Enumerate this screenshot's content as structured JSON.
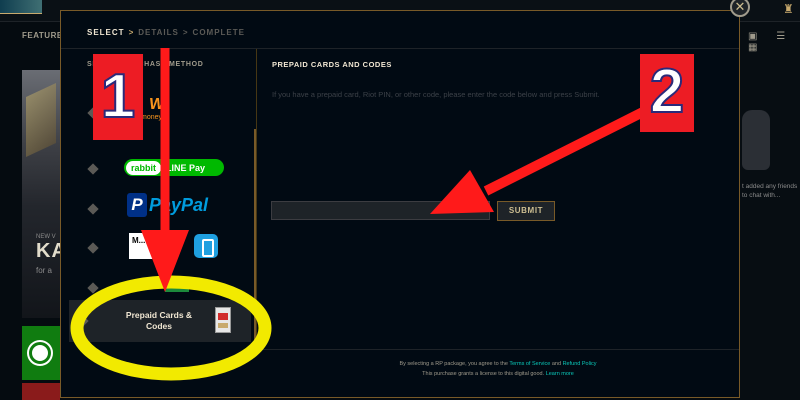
{
  "background": {
    "tab_label": "FEATURE",
    "left_small": "NEW V",
    "left_big": "KA",
    "left_sub": "for a",
    "right_text": "t added any friends to chat with...",
    "right_icons": "▣ ☰ ▦"
  },
  "modal": {
    "breadcrumb": {
      "select": "SELECT",
      "separator": ">",
      "details": "DETAILS",
      "complete": "COMPLETE"
    },
    "close": "✕",
    "sidebar": {
      "title": "SELECT PURCHASE METHOD",
      "items": [
        {
          "name": "TrueMoney",
          "text": "money",
          "diamond": true
        },
        {
          "name": "LINE Pay",
          "part1": "rabbit",
          "part2": "LINE Pay",
          "diamond": true
        },
        {
          "name": "PayPal",
          "mark": "P",
          "text": "PayPal",
          "diamond": true
        },
        {
          "name": "mPay",
          "text": "M... Pa...",
          "diamond": true
        },
        {
          "name": "7-Eleven",
          "diamond": true
        }
      ],
      "selected": {
        "label": "Prepaid Cards & Codes"
      }
    },
    "content": {
      "title": "PREPAID CARDS AND CODES",
      "description": "If you have a prepaid card, Riot PIN, or other code, please enter the code below and press Submit.",
      "code_value": "",
      "submit_label": "SUBMIT"
    },
    "footer": {
      "line1_pre": "By selecting a RP package, you agree to the",
      "terms": "Terms of Service",
      "and": "and",
      "refund": "Refund Policy",
      "line2_pre": "This purchase grants a license to this digital good.",
      "learn_more": "Learn more"
    }
  },
  "annotations": {
    "badge_1": "1",
    "badge_2": "2",
    "arrow_color": "#ff1a1a",
    "circle_color": "#f2ea00"
  }
}
